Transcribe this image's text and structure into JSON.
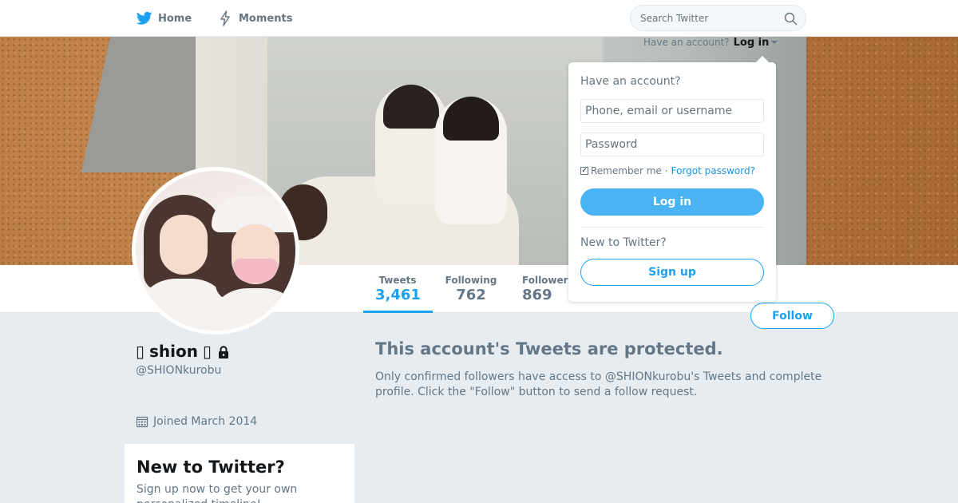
{
  "nav": {
    "home_label": "Home",
    "moments_label": "Moments",
    "search_placeholder": "Search Twitter"
  },
  "login": {
    "prompt": "Have an account?",
    "link_label": "Log in",
    "dropdown_title": "Have an account?",
    "username_placeholder": "Phone, email or username",
    "password_placeholder": "Password",
    "remember_label": "Remember me",
    "separator": "·",
    "forgot_label": "Forgot password?",
    "login_button": "Log in",
    "new_prompt": "New to Twitter?",
    "signup_button": "Sign up"
  },
  "profile": {
    "name": "shion",
    "name_prefix_glyph": "▯",
    "name_suffix_glyph": "▯",
    "handle": "@SHIONkurobu",
    "joined": "Joined March 2014",
    "follow_button": "Follow",
    "stats": [
      {
        "label": "Tweets",
        "value": "3,461"
      },
      {
        "label": "Following",
        "value": "762"
      },
      {
        "label": "Followers",
        "value": "869"
      }
    ]
  },
  "protected": {
    "title": "This account's Tweets are protected.",
    "text": "Only confirmed followers have access to @SHIONkurobu's Tweets and complete profile. Click the \"Follow\" button to send a follow request."
  },
  "signup_box": {
    "title": "New to Twitter?",
    "text": "Sign up now to get your own personalized timeline!"
  },
  "colors": {
    "accent": "#1da1f2",
    "login_button": "#4ab3f4",
    "background": "#e6ecf0",
    "muted_text": "#657786"
  },
  "icons": [
    "twitter-bird-icon",
    "lightning-icon",
    "search-icon",
    "lock-icon",
    "calendar-icon",
    "caret-down-icon"
  ]
}
